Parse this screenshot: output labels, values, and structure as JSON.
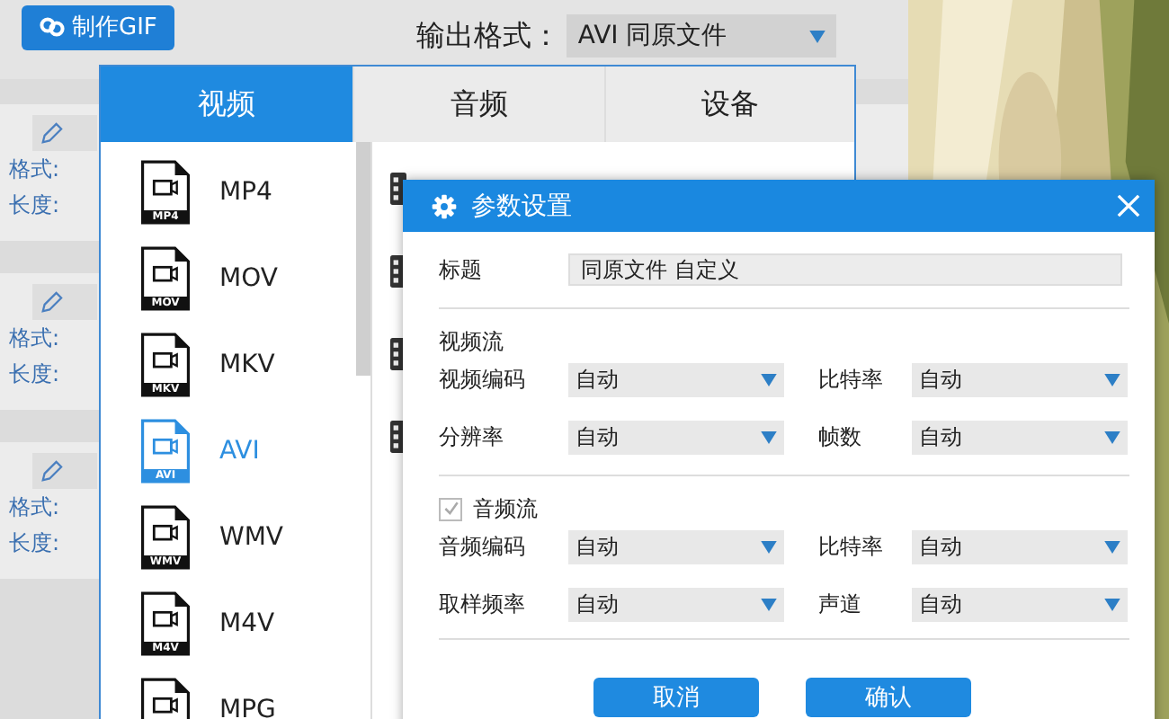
{
  "toolbar": {
    "gif_button": "制作GIF",
    "output_label": "输出格式：",
    "output_value": "AVI  同原文件"
  },
  "tasks": [
    {
      "format_label": "格式:",
      "length_label": "长度:"
    },
    {
      "format_label": "格式:",
      "length_label": "长度:"
    },
    {
      "format_label": "格式:",
      "length_label": "长度:"
    }
  ],
  "format_panel": {
    "tabs": [
      {
        "label": "视频",
        "selected": true
      },
      {
        "label": "音频",
        "selected": false
      },
      {
        "label": "设备",
        "selected": false
      }
    ],
    "formats": [
      {
        "label": "MP4",
        "badge": "MP4",
        "selected": false
      },
      {
        "label": "MOV",
        "badge": "MOV",
        "selected": false
      },
      {
        "label": "MKV",
        "badge": "MKV",
        "selected": false
      },
      {
        "label": "AVI",
        "badge": "AVI",
        "selected": true
      },
      {
        "label": "WMV",
        "badge": "WMV",
        "selected": false
      },
      {
        "label": "M4V",
        "badge": "M4V",
        "selected": false
      },
      {
        "label": "MPG",
        "selected": false
      }
    ]
  },
  "dialog": {
    "title": "参数设置",
    "title_label": "标题",
    "title_value": "同原文件 自定义",
    "sections": [
      {
        "heading": "视频流",
        "kind": "plain",
        "rows": [
          [
            {
              "label": "视频编码",
              "value": "自动"
            },
            {
              "label": "比特率",
              "value": "自动"
            }
          ],
          [
            {
              "label": "分辨率",
              "value": "自动"
            },
            {
              "label": "帧数",
              "value": "自动"
            }
          ]
        ]
      },
      {
        "heading": "音频流",
        "kind": "checkbox",
        "checked": true,
        "rows": [
          [
            {
              "label": "音频编码",
              "value": "自动"
            },
            {
              "label": "比特率",
              "value": "自动"
            }
          ],
          [
            {
              "label": "取样频率",
              "value": "自动"
            },
            {
              "label": "声道",
              "value": "自动"
            }
          ]
        ]
      }
    ],
    "buttons": [
      "取消",
      "确认"
    ]
  }
}
